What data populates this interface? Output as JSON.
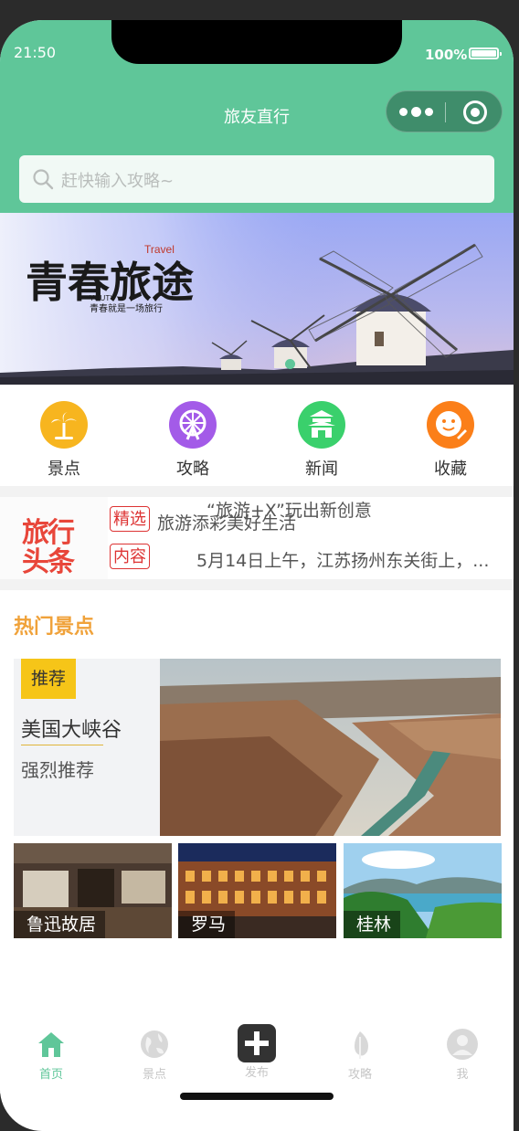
{
  "status_bar": {
    "time": "21:50",
    "battery": "100%"
  },
  "nav": {
    "title": "旅友直行",
    "menu_icon": "more-dots-icon",
    "close_icon": "target-icon"
  },
  "search": {
    "placeholder": "赶快输入攻略~"
  },
  "banner": {
    "title_art": "青春旅途",
    "tag_en": "Travel",
    "brand": "YOUTY",
    "slogan": "青春就是一场旅行"
  },
  "categories": [
    {
      "label": "景点",
      "icon": "palm-tree-icon",
      "color": "#f7b51f"
    },
    {
      "label": "攻略",
      "icon": "ferris-wheel-icon",
      "color": "#a35be8"
    },
    {
      "label": "新闻",
      "icon": "temple-icon",
      "color": "#3ad06c"
    },
    {
      "label": "收藏",
      "icon": "smiley-pen-icon",
      "color": "#fb7f19"
    }
  ],
  "news": {
    "logo_line1": "旅行",
    "logo_line2": "头条",
    "rows": [
      {
        "tag": "精选",
        "text": "旅游添彩美好生活",
        "overlay": "“旅游+X”玩出新创意"
      },
      {
        "tag": "内容",
        "text": "5月14日上午，江苏扬州东关街上，..."
      }
    ]
  },
  "hot": {
    "title": "热门景点",
    "feature": {
      "badge": "推荐",
      "name": "美国大峡谷",
      "sub": "强烈推荐"
    },
    "thumbs": [
      {
        "label": "鲁迅故居"
      },
      {
        "label": "罗马"
      },
      {
        "label": "桂林"
      }
    ]
  },
  "tabbar": [
    {
      "label": "首页",
      "icon": "home-icon",
      "active": true
    },
    {
      "label": "景点",
      "icon": "globe-icon"
    },
    {
      "label": "发布",
      "icon": "plus-icon"
    },
    {
      "label": "攻略",
      "icon": "leaf-icon"
    },
    {
      "label": "我",
      "icon": "user-avatar-icon"
    }
  ],
  "colors": {
    "primary": "#5fc699",
    "accent": "#f0a23a",
    "badge": "#f6c518",
    "tag_red": "#dd3333"
  }
}
